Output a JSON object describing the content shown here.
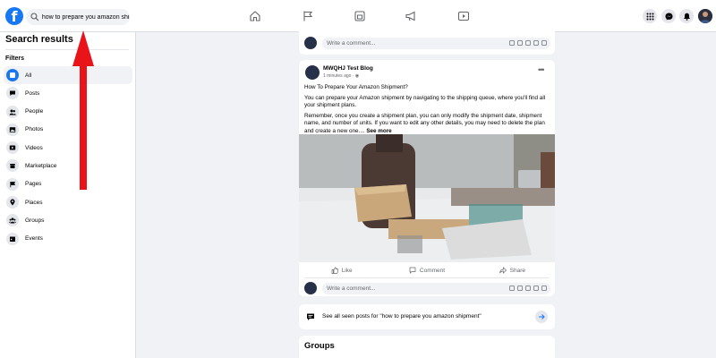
{
  "topbar": {
    "logo_letter": "f",
    "search_value": "how to prepare you amazon shipm",
    "nav_icons": [
      "home-icon",
      "flag-icon",
      "marketplace-icon",
      "megaphone-icon",
      "watch-icon"
    ],
    "right_icons": [
      "menu-grid-icon",
      "messenger-icon",
      "notifications-icon",
      "profile-avatar"
    ]
  },
  "sidebar": {
    "title": "Search results",
    "filters_label": "Filters",
    "items": [
      {
        "label": "All",
        "icon": "all-icon",
        "active": true
      },
      {
        "label": "Posts",
        "icon": "posts-icon"
      },
      {
        "label": "People",
        "icon": "people-icon"
      },
      {
        "label": "Photos",
        "icon": "photos-icon"
      },
      {
        "label": "Videos",
        "icon": "videos-icon"
      },
      {
        "label": "Marketplace",
        "icon": "marketplace-icon"
      },
      {
        "label": "Pages",
        "icon": "pages-icon"
      },
      {
        "label": "Places",
        "icon": "places-icon"
      },
      {
        "label": "Groups",
        "icon": "groups-icon"
      },
      {
        "label": "Events",
        "icon": "events-icon"
      }
    ]
  },
  "feed": {
    "top_comment_placeholder": "Write a comment...",
    "post": {
      "author": "MWQHJ Test Blog",
      "time": "1 minutes ago · ",
      "paragraph1": "How To Prepare Your Amazon Shipment?",
      "paragraph2": "You can prepare your Amazon shipment by navigating to the shipping queue, where you'll find all your shipment plans.",
      "paragraph3": "Remember, once you create a shipment plan, you can only modify the shipment date, shipment name, and number of units. If you want to edit any other details, you may need to delete the plan and create a new one.... ",
      "see_more": "See more",
      "like_label": "Like",
      "comment_label": "Comment",
      "share_label": "Share",
      "comment_placeholder": "Write a comment..."
    },
    "see_all_text": "See all seen posts for \"how to prepare you amazon shipment\"",
    "groups_title": "Groups"
  },
  "colors": {
    "brand": "#1877f2",
    "arrow": "#e8141a",
    "background": "#f0f2f5"
  }
}
